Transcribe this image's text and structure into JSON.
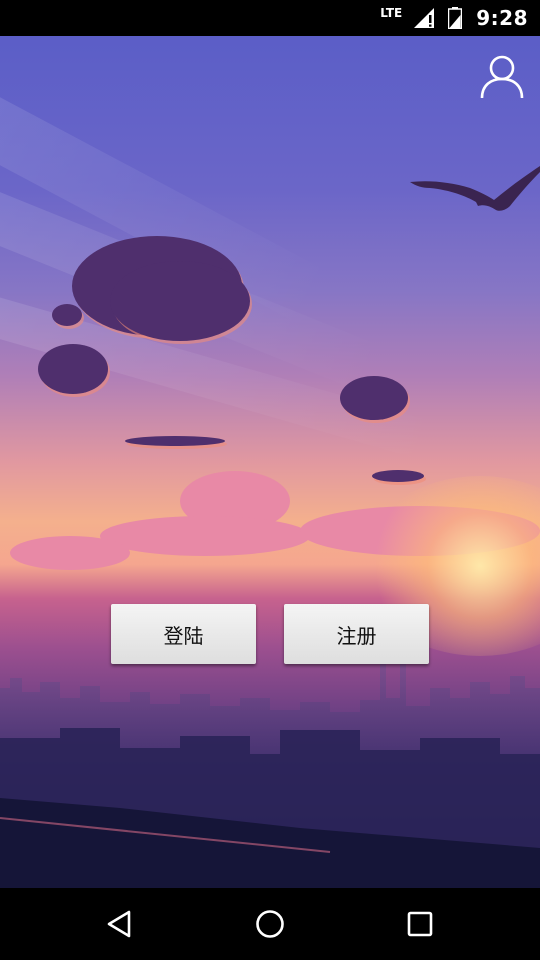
{
  "status_bar": {
    "network": "LTE",
    "time": "9:28",
    "icons": [
      "lte-signal-icon",
      "battery-icon"
    ]
  },
  "header": {
    "profile_icon": "user-profile-icon"
  },
  "main": {
    "login_label": "登陆",
    "register_label": "注册"
  },
  "nav_bar": {
    "icons": [
      "back-icon",
      "home-icon",
      "recent-apps-icon"
    ]
  }
}
